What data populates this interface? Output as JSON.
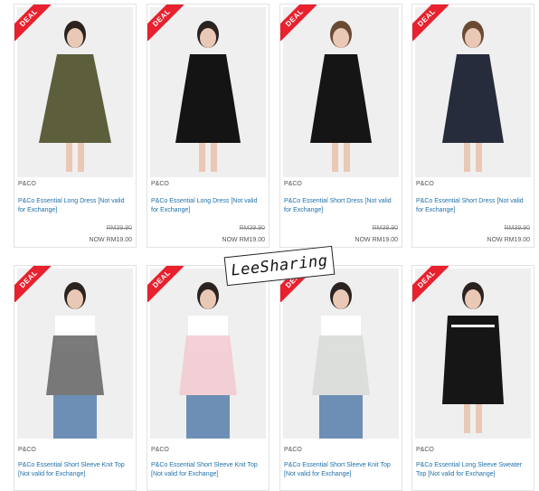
{
  "deal_label": "DEAL",
  "watermark": "LeeSharing",
  "products": [
    {
      "brand": "P&CO",
      "name": "P&Co Essential Long Dress [Not valid for Exchange]",
      "old_price": "RM39.90",
      "now_price": "NOW RM19.00",
      "garment_color": "#5c5e3c"
    },
    {
      "brand": "P&CO",
      "name": "P&Co Essential Long Dress [Not valid for Exchange]",
      "old_price": "RM39.90",
      "now_price": "NOW RM19.00",
      "garment_color": "#141414"
    },
    {
      "brand": "P&CO",
      "name": "P&Co Essential Short Dress [Not valid for Exchange]",
      "old_price": "RM39.90",
      "now_price": "NOW RM19.00",
      "garment_color": "#151515"
    },
    {
      "brand": "P&CO",
      "name": "P&Co Essential Short Dress [Not valid for Exchange]",
      "old_price": "RM39.90",
      "now_price": "NOW RM19.00",
      "garment_color": "#262c3c"
    },
    {
      "brand": "P&CO",
      "name": "P&Co Essential Short Sleeve Knit Top [Not valid for Exchange]",
      "garment_color": "#5a5a5a"
    },
    {
      "brand": "P&CO",
      "name": "P&Co Essential Short Sleeve Knit Top [Not valid for Exchange]",
      "garment_color": "#f2c9cf"
    },
    {
      "brand": "P&CO",
      "name": "P&Co Essential Short Sleeve Knit Top [Not valid for Exchange]",
      "garment_color": "#d9dbd8"
    },
    {
      "brand": "P&CO",
      "name": "P&Co Essential Long Sleeve Sweater Top [Not valid for Exchange]",
      "garment_color": "#161616"
    }
  ]
}
